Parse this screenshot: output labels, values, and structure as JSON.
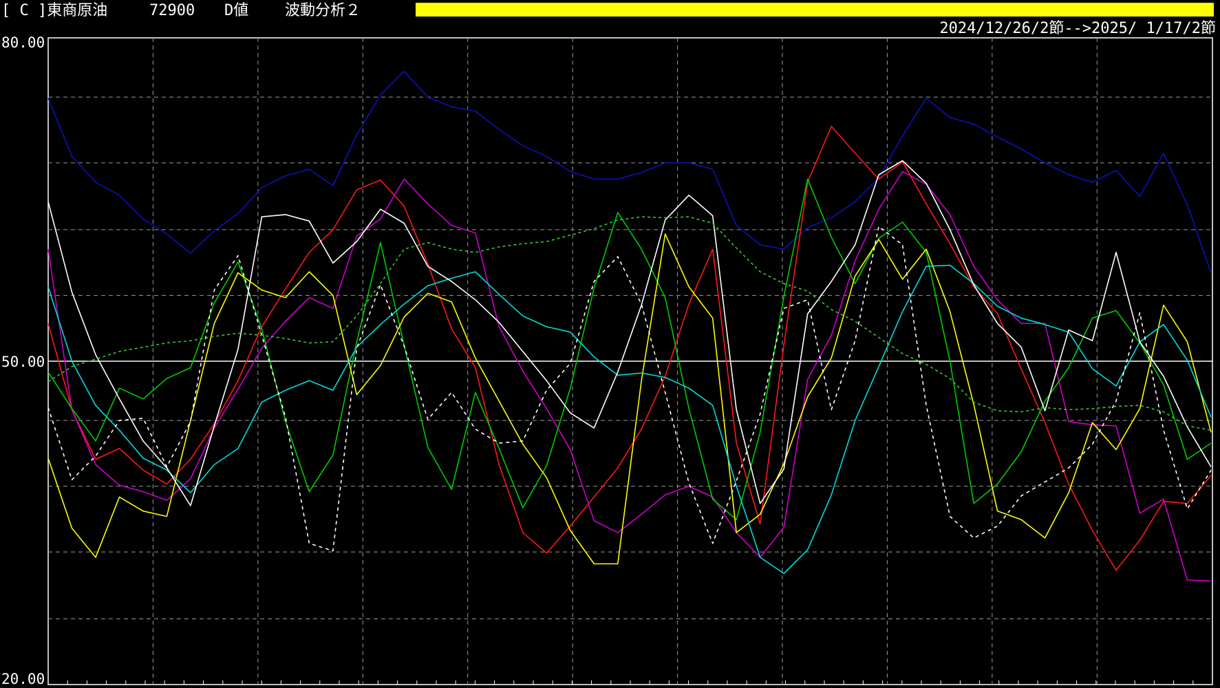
{
  "header": {
    "title": "[ C ]東商原油",
    "code": "72900",
    "value_type": "D値",
    "analysis": "波動分析２",
    "date_range": "2024/12/26/2節-->2025/ 1/17/2節"
  },
  "colors": {
    "background": "#000000",
    "accent_bar": "#ffff00",
    "grid": "#9a9a9a",
    "midline": "#ffffff"
  },
  "chart_data": {
    "type": "line",
    "ylim": [
      20,
      80
    ],
    "yticks": [
      "80.00",
      "50.00",
      "20.00"
    ],
    "midline": 50,
    "vgrid_count": 10,
    "hgrid_values": [
      20,
      26.1,
      32.3,
      38.4,
      44.5,
      50,
      56.1,
      62.2,
      68.4,
      74.5,
      80
    ],
    "x_points": 50,
    "series": [
      {
        "color": "#0a14b4",
        "dash": "",
        "values": [
          74.4,
          69,
          66.6,
          65.4,
          63.2,
          61.8,
          60,
          62.1,
          63.7,
          66.1,
          67.2,
          67.8,
          66.3,
          71,
          74.7,
          76.9,
          74.5,
          73.6,
          73.2,
          71.5,
          70,
          69,
          67.6,
          66.9,
          66.9,
          67.5,
          68.4,
          68.4,
          67.8,
          62.6,
          60.8,
          60.4,
          62.4,
          63.3,
          64.8,
          67,
          70.9,
          74.4,
          72.6,
          72,
          70.8,
          69.7,
          68.4,
          67.3,
          66.6,
          67.7,
          65.3,
          69.3,
          64.5,
          58.2
        ]
      },
      {
        "color": "#ff1818",
        "dash": "",
        "values": [
          53.5,
          45.5,
          40.9,
          41.9,
          39.9,
          38.6,
          40.9,
          44.2,
          48.2,
          53.2,
          56.7,
          60.1,
          62.2,
          65.9,
          66.8,
          64.4,
          59,
          53,
          49.4,
          40.4,
          34.1,
          32.2,
          34.7,
          37.4,
          40.1,
          43.7,
          48.6,
          55.3,
          60.4,
          42.4,
          34.9,
          51.5,
          66.6,
          71.8,
          69.3,
          66.9,
          68.5,
          64.6,
          60.9,
          56.9,
          54.4,
          49.3,
          44.3,
          38.6,
          34.3,
          30.6,
          33.4,
          37,
          36.8,
          39.4
        ]
      },
      {
        "color": "#cc00cc",
        "dash": "",
        "values": [
          60.4,
          45.5,
          40.4,
          38.5,
          37.9,
          37.1,
          39.1,
          43.8,
          47.4,
          51.2,
          53.7,
          55.9,
          54.9,
          61.6,
          63.2,
          66.9,
          64.6,
          62.6,
          61.9,
          53.2,
          49.1,
          45.6,
          41.8,
          35.2,
          34.1,
          35.8,
          37.6,
          38.4,
          37.4,
          34.1,
          31.8,
          34.6,
          48.3,
          52.4,
          59.3,
          64.1,
          67.6,
          66.4,
          63.6,
          58.8,
          55.7,
          53.5,
          53.5,
          44.4,
          44.1,
          44,
          35.9,
          37.2,
          29.7,
          29.6
        ]
      },
      {
        "color": "#00cc00",
        "dash": "",
        "values": [
          49,
          45.6,
          42.6,
          47.5,
          46.5,
          48.4,
          49.4,
          55.4,
          59.2,
          53,
          44.4,
          37.9,
          41.3,
          51.8,
          61,
          51.5,
          42,
          38.1,
          47.1,
          41.9,
          36.4,
          40.3,
          47.5,
          56.8,
          63.8,
          60.4,
          55.9,
          45.6,
          37.2,
          35.3,
          43.4,
          56,
          66.9,
          61.5,
          57.2,
          61.4,
          62.9,
          60.1,
          50,
          36.8,
          38.6,
          41.6,
          46.3,
          49.4,
          54,
          54.7,
          51.7,
          47.8,
          40.9,
          42.4
        ]
      },
      {
        "color": "#ffff00",
        "dash": "",
        "values": [
          41,
          34.5,
          31.8,
          37.4,
          36.1,
          35.6,
          44.5,
          53.5,
          58.2,
          56.6,
          55.9,
          58.3,
          56.1,
          46.9,
          49.6,
          54.1,
          56.3,
          55.5,
          50.3,
          46.3,
          42.3,
          39.2,
          34.3,
          31.2,
          31.2,
          48.2,
          61.8,
          56.9,
          54,
          34.1,
          35.8,
          40.5,
          46.7,
          50.3,
          57.9,
          61.3,
          57.6,
          60.4,
          54.6,
          46,
          36.1,
          35.3,
          33.6,
          37.8,
          44.3,
          41.8,
          45.6,
          55.2,
          51.8,
          43.4
        ]
      },
      {
        "color": "#00dddd",
        "dash": "",
        "values": [
          56.9,
          50,
          45.9,
          43.6,
          41,
          39.9,
          37.8,
          40.4,
          41.9,
          46.2,
          47.3,
          48.2,
          47.3,
          51.3,
          53.4,
          55.3,
          57,
          57.7,
          58.3,
          56.2,
          54.2,
          53.2,
          52.7,
          50.4,
          48.7,
          48.9,
          48.5,
          47.5,
          45.9,
          38.4,
          31.8,
          30.3,
          32.5,
          37.6,
          44.5,
          49.5,
          54.6,
          58.8,
          58.9,
          57.2,
          55.1,
          54,
          53.4,
          52.7,
          49.3,
          47.7,
          51.8,
          53.4,
          50.1,
          44.8
        ]
      },
      {
        "color": "#ffffff",
        "dash": "",
        "values": [
          64.8,
          56.4,
          50.6,
          46.5,
          42.6,
          40.1,
          36.6,
          44,
          51.1,
          63.4,
          63.6,
          63,
          59.1,
          61.1,
          64.1,
          62.8,
          58.8,
          57.4,
          55.7,
          53.6,
          50.9,
          48.2,
          45.2,
          43.8,
          49,
          55.2,
          63.1,
          65.4,
          63.5,
          45.5,
          36.8,
          40,
          54.4,
          57.4,
          60.8,
          67.3,
          68.6,
          66.5,
          62.2,
          57.1,
          53.5,
          51.3,
          45.4,
          52.9,
          51.9,
          60.1,
          51.8,
          48.6,
          43.9,
          40.2
        ]
      },
      {
        "color": "#ffffff",
        "dash": "5,5",
        "values": [
          45.7,
          39,
          41.2,
          44.5,
          44.7,
          40.2,
          44.4,
          56.6,
          59.8,
          52.4,
          44.8,
          33.1,
          32.4,
          51.2,
          57.1,
          51.4,
          44.6,
          47.1,
          43.7,
          42.4,
          42.6,
          47.3,
          49.8,
          57.4,
          59.7,
          55.3,
          47.1,
          38.7,
          33.1,
          38.9,
          45.1,
          54.9,
          55.7,
          45.5,
          51.9,
          62.5,
          60.8,
          45.9,
          35.6,
          33.6,
          34.7,
          37.5,
          38.8,
          40.1,
          42.3,
          46.3,
          54.5,
          43.6,
          36.3,
          39.9
        ]
      },
      {
        "color": "#33cc33",
        "dash": "4,4",
        "values": [
          48.1,
          49.5,
          50.2,
          50.9,
          51.3,
          51.7,
          51.9,
          52.3,
          52.6,
          52.4,
          52.1,
          51.7,
          51.8,
          54.2,
          57.2,
          60.4,
          61,
          60.4,
          60.1,
          60.6,
          60.9,
          61.1,
          61.7,
          62.3,
          63.1,
          63.4,
          63.3,
          63.4,
          62.8,
          60.5,
          58.3,
          57.2,
          56.5,
          54.8,
          53.7,
          52.2,
          50.7,
          49.7,
          48.4,
          46.2,
          45.4,
          45.3,
          45.7,
          45.5,
          45.6,
          45.8,
          45.9,
          45.3,
          44,
          43.6
        ]
      }
    ]
  }
}
